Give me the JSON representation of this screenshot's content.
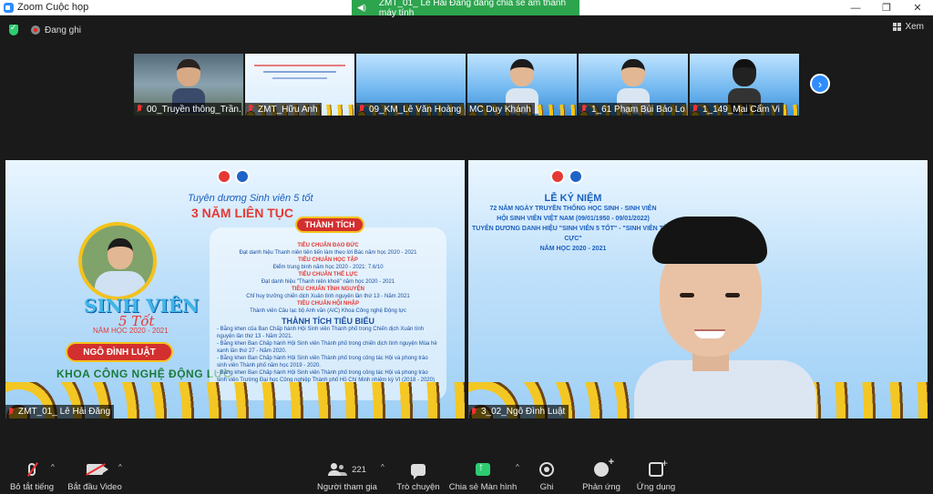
{
  "window": {
    "title": "Zoom Cuộc họp",
    "controls": [
      "minimize-icon",
      "restore-icon",
      "close-icon"
    ]
  },
  "share_banner": {
    "text": "ZMT_01_ Lê Hải Đăng đang chia sẻ âm thanh máy tính"
  },
  "status": {
    "recording_label": "Đang ghi",
    "view_label": "Xem"
  },
  "thumbnails": [
    {
      "name": "00_Truyền thông_Trần...",
      "type": "photo"
    },
    {
      "name": "ZMT_Hữu Anh",
      "type": "slide-light"
    },
    {
      "name": "09_KM_Lê Văn Hoàng",
      "type": "slide"
    },
    {
      "name": "MC Duy Khánh",
      "type": "person"
    },
    {
      "name": "1_61 Phạm Bùi Bảo Lo...",
      "type": "person-glasses"
    },
    {
      "name": "1_149_Mai Cẩm Vi",
      "type": "person-back"
    }
  ],
  "left_tile": {
    "name": "ZMT_01_ Lê Hải Đăng",
    "slide": {
      "campaign": "Tuyên dương Sinh viên 5 tốt",
      "big_title": "3 NĂM LIÊN TỤC",
      "sv5t": "SINH VIÊN",
      "sv5t_sub": "5 Tốt",
      "year_line": "NĂM HỌC 2020 - 2021",
      "person_name": "NGÔ ĐÌNH LUẬT",
      "faculty": "KHOA CÔNG NGHỆ ĐỘNG LỰC",
      "achievements_btn": "THÀNH TÍCH",
      "criteria": [
        {
          "head": "TIÊU CHUẨN ĐẠO ĐỨC",
          "line": "Đạt danh hiệu Thanh niên tiên tiến làm theo lời Bác năm học 2020 - 2021"
        },
        {
          "head": "TIÊU CHUẨN HỌC TẬP",
          "line": "Điểm trung bình năm học 2020 - 2021: 7.6/10"
        },
        {
          "head": "TIÊU CHUẨN THỂ LỰC",
          "line": "Đạt danh hiệu \"Thanh niên khoẻ\" năm học 2020 - 2021"
        },
        {
          "head": "TIÊU CHUẨN TÌNH NGUYỆN",
          "line": "Chỉ huy trưởng chiến dịch Xuân tình nguyện lần thứ 13 - Năm 2021"
        },
        {
          "head": "TIÊU CHUẨN HỘI NHẬP",
          "line": "Thành viên Câu lạc bộ Anh văn (AIC) Khoa Công nghệ Động lực"
        }
      ],
      "highlights_title": "THÀNH TÍCH TIÊU BIỂU",
      "highlights": [
        "- Bằng khen của Ban Chấp hành Hội Sinh viên Thành phố trong Chiến dịch Xuân tình nguyện lần thứ 13 - Năm 2021.",
        "- Bằng khen Ban Chấp hành Hội Sinh viên Thành phố trong chiến dịch tình nguyện Mùa hè xanh lần thứ 27 - Năm 2020.",
        "- Bằng khen Ban Chấp hành Hội Sinh viên Thành phố trong công tác Hội và phong trào sinh viên Thành phố năm học 2019 - 2020.",
        "- Bằng khen Ban Chấp hành Hội Sinh viên Thành phố trong công tác Hội và phong trào sinh viên Trường Đại học Công nghiệp Thành phố Hồ Chí Minh nhiệm kỳ VI (2018 - 2020)"
      ]
    }
  },
  "right_tile": {
    "name": "3_02_Ngô Đình Luật",
    "slide": {
      "lines": [
        "LỄ KỶ NIỆM",
        "72 NĂM NGÀY TRUYỀN THỐNG HỌC SINH - SINH VIÊN",
        "HỘI SINH VIÊN VIỆT NAM (09/01/1950 - 09/01/2022)",
        "TUYÊN DƯƠNG DANH HIỆU \"SINH VIÊN 5 TỐT\" - \"SINH VIÊN TÍCH CỰC\"",
        "NĂM HỌC 2020 - 2021"
      ]
    }
  },
  "toolbar": {
    "mute": "Bỏ tắt tiếng",
    "video": "Bắt đầu Video",
    "participants": "Người tham gia",
    "participants_count": "221",
    "chat": "Trò chuyện",
    "share": "Chia sẻ Màn hình",
    "record": "Ghi",
    "reactions": "Phản ứng",
    "apps": "Ứng dụng"
  }
}
